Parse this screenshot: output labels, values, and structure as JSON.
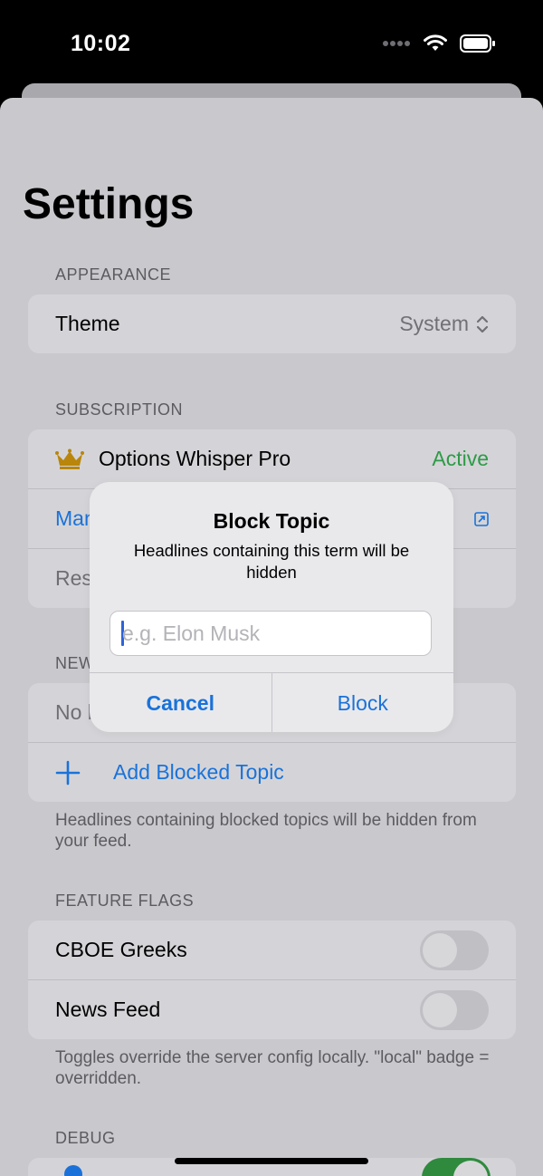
{
  "status_bar": {
    "time": "10:02"
  },
  "page_title": "Settings",
  "appearance": {
    "header": "APPEARANCE",
    "theme_label": "Theme",
    "theme_value": "System"
  },
  "subscription": {
    "header": "SUBSCRIPTION",
    "product_name": "Options Whisper Pro",
    "status": "Active",
    "manage_label": "Manage Subscription",
    "restore_label": "Restore Purchases"
  },
  "news_filter": {
    "header": "NEWS FILTER",
    "empty_label": "No blocked topics",
    "add_label": "Add Blocked Topic",
    "footer": "Headlines containing blocked topics will be hidden from your feed."
  },
  "feature_flags": {
    "header": "FEATURE FLAGS",
    "items": [
      {
        "label": "CBOE Greeks",
        "enabled": false
      },
      {
        "label": "News Feed",
        "enabled": false
      }
    ],
    "footer": "Toggles override the server config locally. \"local\" badge = overridden."
  },
  "debug": {
    "header": "DEBUG"
  },
  "alert": {
    "title": "Block Topic",
    "message": "Headlines containing this term will be hidden",
    "input_placeholder": "e.g. Elon Musk",
    "cancel_label": "Cancel",
    "confirm_label": "Block"
  },
  "colors": {
    "accent": "#1a72d9",
    "active_green": "#2e9a47",
    "crown_gold": "#b9860b",
    "dim_overlay": "#c9c9cd"
  }
}
